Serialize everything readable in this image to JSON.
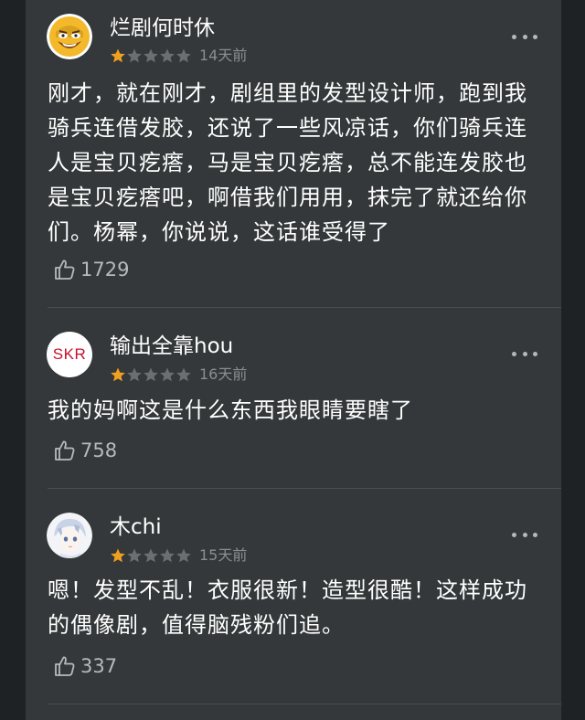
{
  "comments": [
    {
      "username": "烂剧何时休",
      "time": "14天前",
      "rating": 1,
      "max_rating": 5,
      "avatar_icon": "clash-barbarian-avatar-icon",
      "text": "刚才，就在刚才，剧组里的发型设计师，跑到我骑兵连借发胶，还说了一些风凉话，你们骑兵连人是宝贝疙瘩，马是宝贝疙瘩，总不能连发胶也是宝贝疙瘩吧，啊借我们用用，抹完了就还给你们。杨幂，你说说，这话谁受得了",
      "likes": "1729"
    },
    {
      "username": "输出全靠hou",
      "time": "16天前",
      "rating": 1,
      "max_rating": 5,
      "avatar_text": "SKR",
      "text": "我的妈啊这是什么东西我眼睛要瞎了",
      "likes": "758"
    },
    {
      "username": "木chi",
      "time": "15天前",
      "rating": 1,
      "max_rating": 5,
      "avatar_icon": "anime-boy-avatar-icon",
      "text": "嗯！发型不乱！衣服很新！造型很酷！这样成功的偶像剧，值得脑残粉们追。",
      "likes": "337"
    }
  ],
  "icons": {
    "more": "more-dots-icon",
    "like": "thumbs-up-icon",
    "star": "star-icon"
  },
  "colors": {
    "star_filled": "#f0a020",
    "star_empty": "#6b6f71",
    "card_bg": "#34383a",
    "page_bg": "#1e2224",
    "text": "#ffffff",
    "muted": "#8a8e90"
  }
}
